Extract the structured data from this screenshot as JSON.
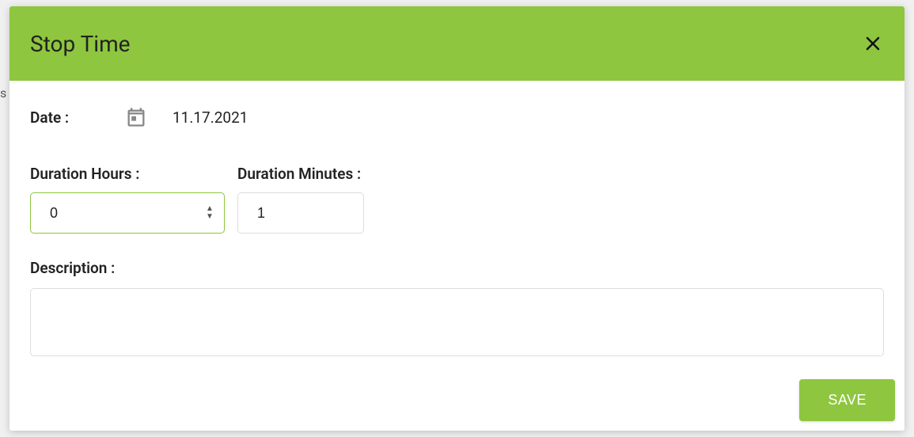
{
  "backdrop": {
    "hint_text": "s"
  },
  "modal": {
    "title": "Stop Time",
    "date_label": "Date :",
    "date_value": "11.17.2021",
    "hours_label": "Duration Hours :",
    "hours_value": "0",
    "minutes_label": "Duration Minutes :",
    "minutes_value": "1",
    "description_label": "Description :",
    "description_value": "",
    "save_label": "SAVE"
  },
  "colors": {
    "accent": "#8ec63f"
  }
}
